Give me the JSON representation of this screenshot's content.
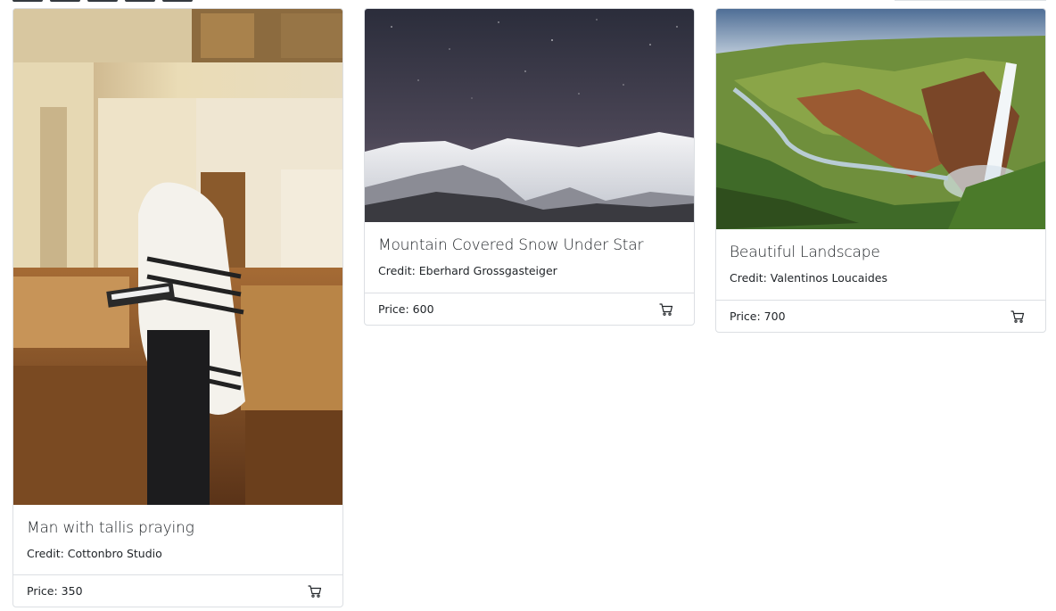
{
  "products": [
    {
      "title": "Man with tallis praying",
      "credit": "Credit: Cottonbro Studio",
      "price": "Price: 350",
      "image": "synagogue-prayer-photo",
      "cart_icon": "shopping-cart-icon"
    },
    {
      "title": "Mountain Covered Snow Under Star",
      "credit": "Credit: Eberhard Grossgasteiger",
      "price": "Price: 600",
      "image": "snowy-mountain-night-sky-photo",
      "cart_icon": "shopping-cart-icon"
    },
    {
      "title": "Beautiful Landscape",
      "credit": "Credit: Valentinos Loucaides",
      "price": "Price: 700",
      "image": "waterfall-canyon-landscape-photo",
      "cart_icon": "shopping-cart-icon"
    }
  ]
}
